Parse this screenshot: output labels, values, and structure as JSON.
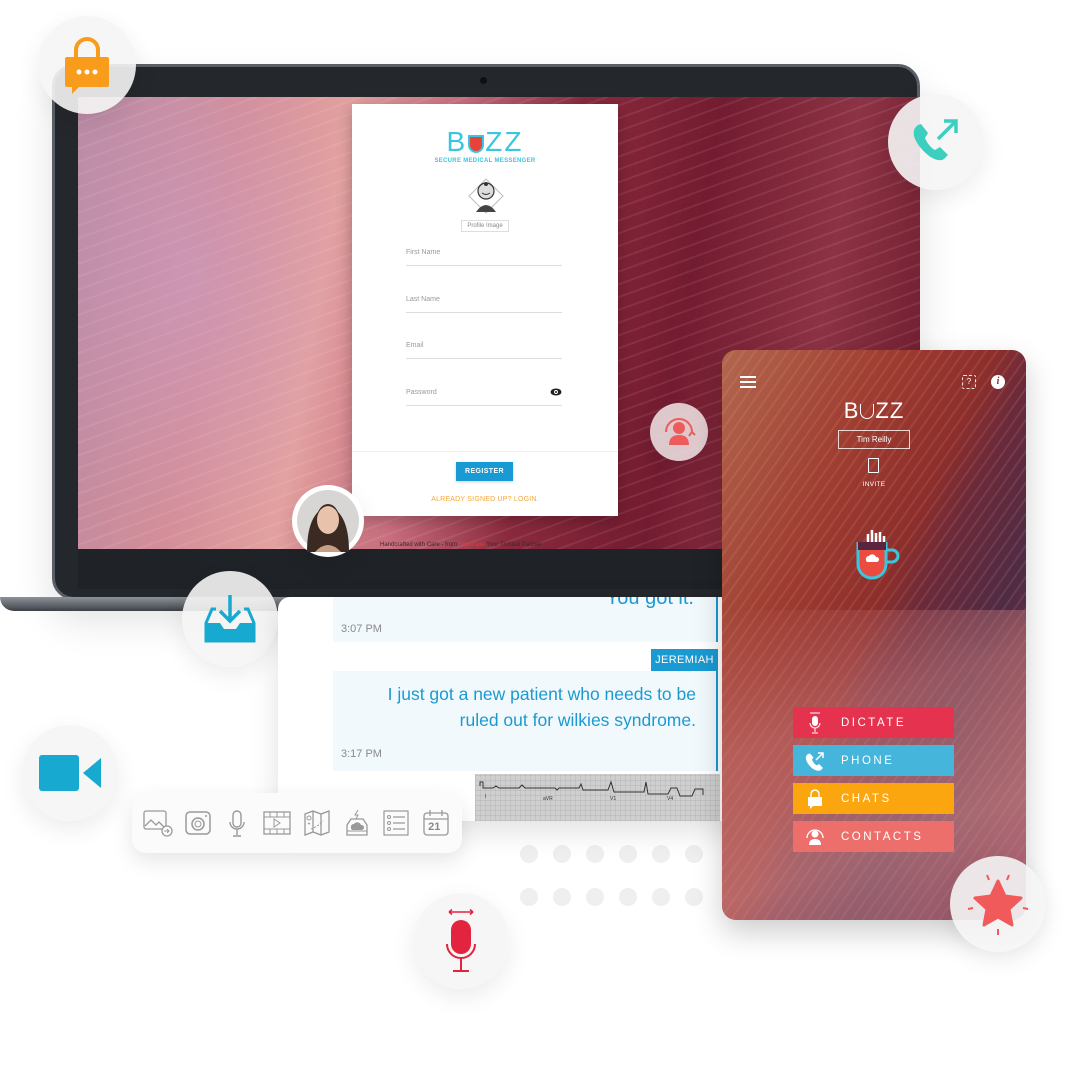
{
  "laptop": {
    "register_card": {
      "logo_text_pre": "B",
      "logo_text_post": "ZZ",
      "tagline": "SECURE MEDICAL MESSENGER",
      "profile_image_label": "Profile Image",
      "fields": [
        {
          "placeholder": "First Name",
          "value": ""
        },
        {
          "placeholder": "Last Name",
          "value": ""
        },
        {
          "placeholder": "Email",
          "value": ""
        },
        {
          "placeholder": "Password",
          "value": ""
        }
      ],
      "register_button": "REGISTER",
      "login_link": "ALREADY SIGNED UP? LOGIN."
    },
    "footer": {
      "prefix": "Handcrafted with Care - from ",
      "brand": "Skyscape",
      "suffix": " Your Trusted Partner"
    }
  },
  "chat": {
    "messages": [
      {
        "text_cut": "You got it.",
        "time": "3:07 PM"
      },
      {
        "sender": "JEREMIAH",
        "text": "I just got a new patient who needs to be ruled out for wilkies syndrome.",
        "time": "3:17 PM"
      }
    ],
    "attachment": {
      "type": "ecg-image",
      "leads": [
        "I",
        "aVR",
        "V1",
        "V4"
      ]
    }
  },
  "toolbar": {
    "icons": [
      "image-share-icon",
      "camera-icon",
      "microphone-icon",
      "video-icon",
      "map-icon",
      "cloud-drive-icon",
      "checklist-icon",
      "calendar-icon"
    ],
    "calendar_day": "21"
  },
  "phone": {
    "logo_pre": "B",
    "logo_post": "ZZ",
    "user_name": "Tim Reilly",
    "invite_label": "INVITE",
    "buttons": [
      {
        "label": "DICTATE",
        "icon": "microphone-icon",
        "color": "#e5324f"
      },
      {
        "label": "PHONE",
        "icon": "phone-outgoing-icon",
        "color": "#45b5dc"
      },
      {
        "label": "CHATS",
        "icon": "lock-chat-icon",
        "color": "#fba50f"
      },
      {
        "label": "CONTACTS",
        "icon": "contact-icon",
        "color": "#ed6f6c"
      }
    ]
  },
  "floating_icons": {
    "lock_chat": {
      "color": "#f99c1c"
    },
    "phone_outgoing": {
      "color": "#3ccfc0"
    },
    "contact_sync": {
      "color": "#ee5b5b"
    },
    "inbox_download": {
      "color": "#17a9cf"
    },
    "video_camera": {
      "color": "#17a9cf"
    },
    "microphone": {
      "color": "#e3243f"
    },
    "star": {
      "color": "#f05a5a"
    }
  }
}
